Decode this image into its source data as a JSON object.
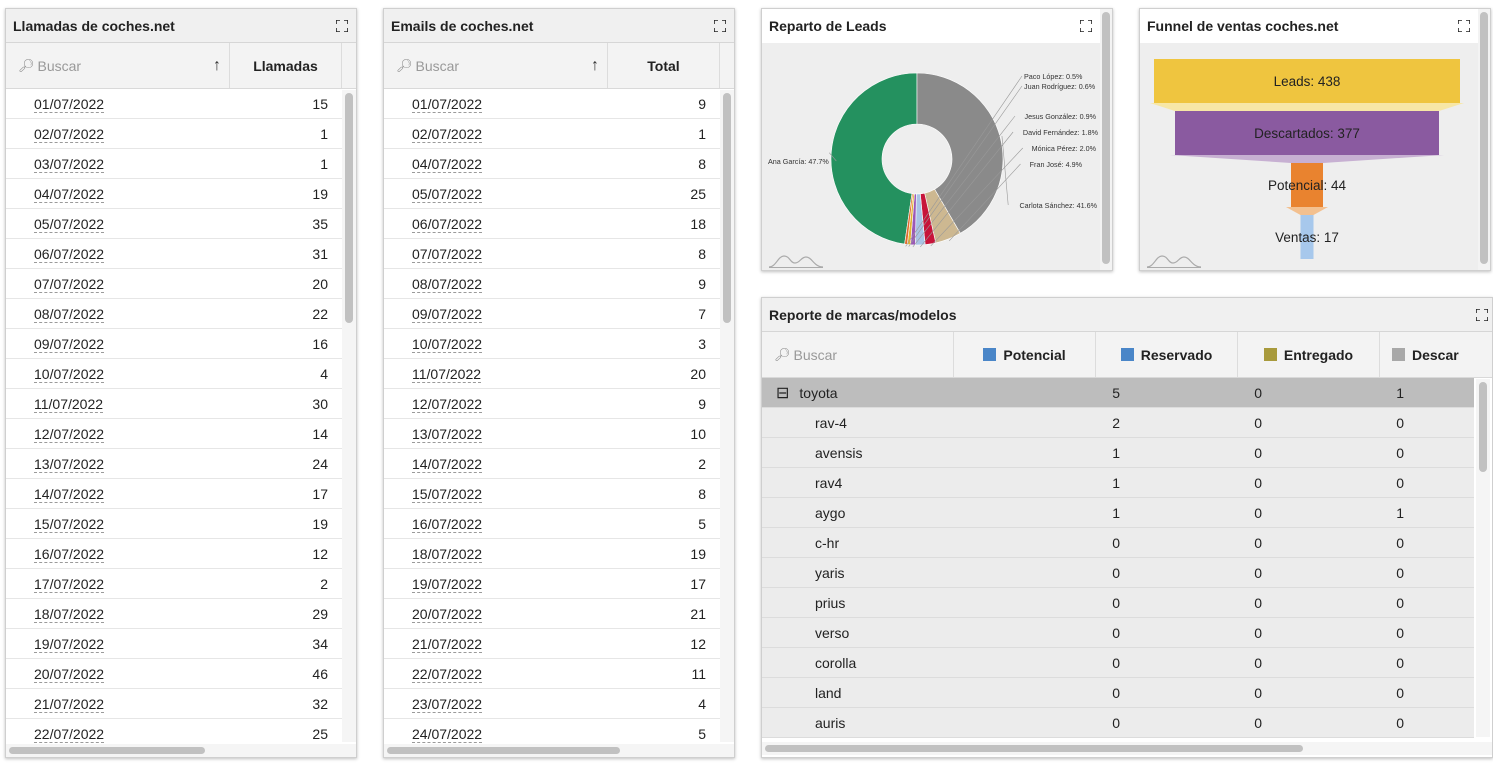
{
  "llamadas": {
    "title": "Llamadas de coches.net",
    "search_placeholder": "Buscar",
    "col_header": "Llamadas",
    "rows": [
      {
        "date": "01/07/2022",
        "value": "15"
      },
      {
        "date": "02/07/2022",
        "value": "1"
      },
      {
        "date": "03/07/2022",
        "value": "1"
      },
      {
        "date": "04/07/2022",
        "value": "19"
      },
      {
        "date": "05/07/2022",
        "value": "35"
      },
      {
        "date": "06/07/2022",
        "value": "31"
      },
      {
        "date": "07/07/2022",
        "value": "20"
      },
      {
        "date": "08/07/2022",
        "value": "22"
      },
      {
        "date": "09/07/2022",
        "value": "16"
      },
      {
        "date": "10/07/2022",
        "value": "4"
      },
      {
        "date": "11/07/2022",
        "value": "30"
      },
      {
        "date": "12/07/2022",
        "value": "14"
      },
      {
        "date": "13/07/2022",
        "value": "24"
      },
      {
        "date": "14/07/2022",
        "value": "17"
      },
      {
        "date": "15/07/2022",
        "value": "19"
      },
      {
        "date": "16/07/2022",
        "value": "12"
      },
      {
        "date": "17/07/2022",
        "value": "2"
      },
      {
        "date": "18/07/2022",
        "value": "29"
      },
      {
        "date": "19/07/2022",
        "value": "34"
      },
      {
        "date": "20/07/2022",
        "value": "46"
      },
      {
        "date": "21/07/2022",
        "value": "32"
      },
      {
        "date": "22/07/2022",
        "value": "25"
      }
    ]
  },
  "emails": {
    "title": "Emails de coches.net",
    "search_placeholder": "Buscar",
    "col_header": "Total",
    "rows": [
      {
        "date": "01/07/2022",
        "value": "9"
      },
      {
        "date": "02/07/2022",
        "value": "1"
      },
      {
        "date": "04/07/2022",
        "value": "8"
      },
      {
        "date": "05/07/2022",
        "value": "25"
      },
      {
        "date": "06/07/2022",
        "value": "18"
      },
      {
        "date": "07/07/2022",
        "value": "8"
      },
      {
        "date": "08/07/2022",
        "value": "9"
      },
      {
        "date": "09/07/2022",
        "value": "7"
      },
      {
        "date": "10/07/2022",
        "value": "3"
      },
      {
        "date": "11/07/2022",
        "value": "20"
      },
      {
        "date": "12/07/2022",
        "value": "9"
      },
      {
        "date": "13/07/2022",
        "value": "10"
      },
      {
        "date": "14/07/2022",
        "value": "2"
      },
      {
        "date": "15/07/2022",
        "value": "8"
      },
      {
        "date": "16/07/2022",
        "value": "5"
      },
      {
        "date": "18/07/2022",
        "value": "19"
      },
      {
        "date": "19/07/2022",
        "value": "17"
      },
      {
        "date": "20/07/2022",
        "value": "21"
      },
      {
        "date": "21/07/2022",
        "value": "12"
      },
      {
        "date": "22/07/2022",
        "value": "11"
      },
      {
        "date": "23/07/2022",
        "value": "4"
      },
      {
        "date": "24/07/2022",
        "value": "5"
      }
    ]
  },
  "reparto": {
    "title": "Reparto de Leads"
  },
  "funnel": {
    "title": "Funnel de ventas coches.net"
  },
  "marcas": {
    "title": "Reporte de marcas/modelos",
    "search_placeholder": "Buscar",
    "columns": [
      {
        "label": "Potencial",
        "color": "#4a86c8"
      },
      {
        "label": "Reservado",
        "color": "#4a86c8"
      },
      {
        "label": "Entregado",
        "color": "#a89a3c"
      },
      {
        "label": "Descar",
        "color": "#a8a8a8"
      }
    ],
    "group": {
      "name": "toyota",
      "toggle": "⊟",
      "values": [
        "5",
        "0",
        "1"
      ]
    },
    "rows": [
      {
        "name": "rav-4",
        "values": [
          "2",
          "0",
          "0"
        ]
      },
      {
        "name": "avensis",
        "values": [
          "1",
          "0",
          "0"
        ]
      },
      {
        "name": "rav4",
        "values": [
          "1",
          "0",
          "0"
        ]
      },
      {
        "name": "aygo",
        "values": [
          "1",
          "0",
          "1"
        ]
      },
      {
        "name": "c-hr",
        "values": [
          "0",
          "0",
          "0"
        ]
      },
      {
        "name": "yaris",
        "values": [
          "0",
          "0",
          "0"
        ]
      },
      {
        "name": "prius",
        "values": [
          "0",
          "0",
          "0"
        ]
      },
      {
        "name": "verso",
        "values": [
          "0",
          "0",
          "0"
        ]
      },
      {
        "name": "corolla",
        "values": [
          "0",
          "0",
          "0"
        ]
      },
      {
        "name": "land",
        "values": [
          "0",
          "0",
          "0"
        ]
      },
      {
        "name": "auris",
        "values": [
          "0",
          "0",
          "0"
        ]
      }
    ]
  },
  "chart_data": [
    {
      "type": "pie",
      "title": "Reparto de Leads",
      "slices": [
        {
          "label": "Ana García: 47.7%",
          "name": "Ana García",
          "value": 47.7,
          "color": "#24915f"
        },
        {
          "label": "Carlota Sánchez: 41.6%",
          "name": "Carlota Sánchez",
          "value": 41.6,
          "color": "#8a8a8a"
        },
        {
          "label": "Fran José: 4.9%",
          "name": "Fran José",
          "value": 4.9,
          "color": "#cdb891"
        },
        {
          "label": "Mónica Pérez: 2.0%",
          "name": "Mónica Pérez",
          "value": 2.0,
          "color": "#c7143a"
        },
        {
          "label": "David Fernández: 1.8%",
          "name": "David Fernández",
          "value": 1.8,
          "color": "#a9c4e6"
        },
        {
          "label": "Jesus González: 0.9%",
          "name": "Jesus González",
          "value": 0.9,
          "color": "#9b59b6"
        },
        {
          "label": "Juan Rodríguez: 0.6%",
          "name": "Juan Rodríguez",
          "value": 0.6,
          "color": "#e0b431"
        },
        {
          "label": "Paco López: 0.5%",
          "name": "Paco López",
          "value": 0.5,
          "color": "#e06a2e"
        }
      ]
    },
    {
      "type": "funnel",
      "title": "Funnel de ventas coches.net",
      "stages": [
        {
          "name": "Leads",
          "value": 438,
          "label": "Leads: 438",
          "color": "#efc53f",
          "fade": "#f7e7a6"
        },
        {
          "name": "Descartados",
          "value": 377,
          "label": "Descartados: 377",
          "color": "#8a5aa0",
          "fade": "#c7b0d2"
        },
        {
          "name": "Potencial",
          "value": 44,
          "label": "Potencial: 44",
          "color": "#e9832f",
          "fade": "#f3c08f"
        },
        {
          "name": "Ventas",
          "value": 17,
          "label": "Ventas: 17",
          "color": "#a7c8ec",
          "fade": "#d4e4f5"
        }
      ]
    }
  ]
}
